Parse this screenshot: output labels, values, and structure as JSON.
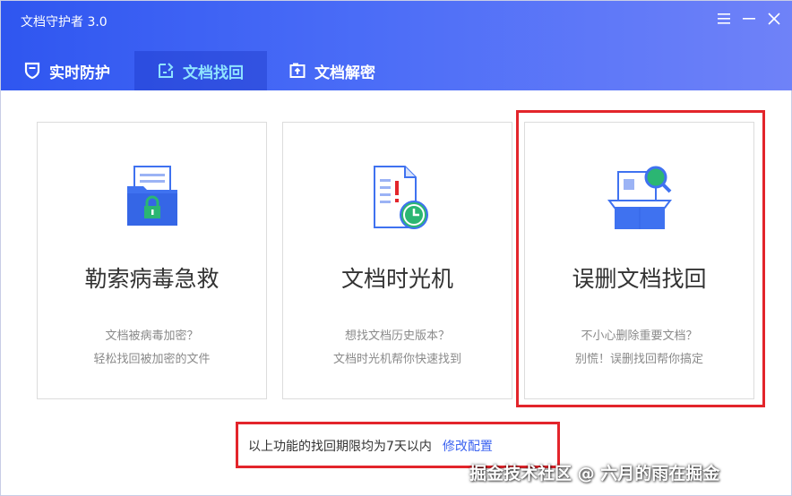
{
  "window": {
    "title": "文档守护者 3.0"
  },
  "tabs": [
    {
      "label": "实时防护",
      "active": false
    },
    {
      "label": "文档找回",
      "active": true
    },
    {
      "label": "文档解密",
      "active": false
    }
  ],
  "cards": [
    {
      "title": "勒索病毒急救",
      "desc_line1": "文档被病毒加密？",
      "desc_line2": "轻松找回被加密的文件"
    },
    {
      "title": "文档时光机",
      "desc_line1": "想找文档历史版本？",
      "desc_line2": "文档时光机帮你快速找到"
    },
    {
      "title": "误删文档找回",
      "desc_line1": "不小心删除重要文档？",
      "desc_line2": "别慌！误删找回帮你搞定"
    }
  ],
  "footer": {
    "notice": "以上功能的找回期限均为7天以内",
    "link": "修改配置"
  },
  "watermark": "掘金技术社区 @ 六月的雨在掘金",
  "colors": {
    "titlebar_start": "#2f56f0",
    "titlebar_end": "#6f82f8",
    "active_tab_text": "#8fe3ff",
    "icon_blue": "#3f72f0",
    "icon_green": "#2bb673",
    "highlight_red": "#e3252b",
    "link": "#3b63f0"
  }
}
